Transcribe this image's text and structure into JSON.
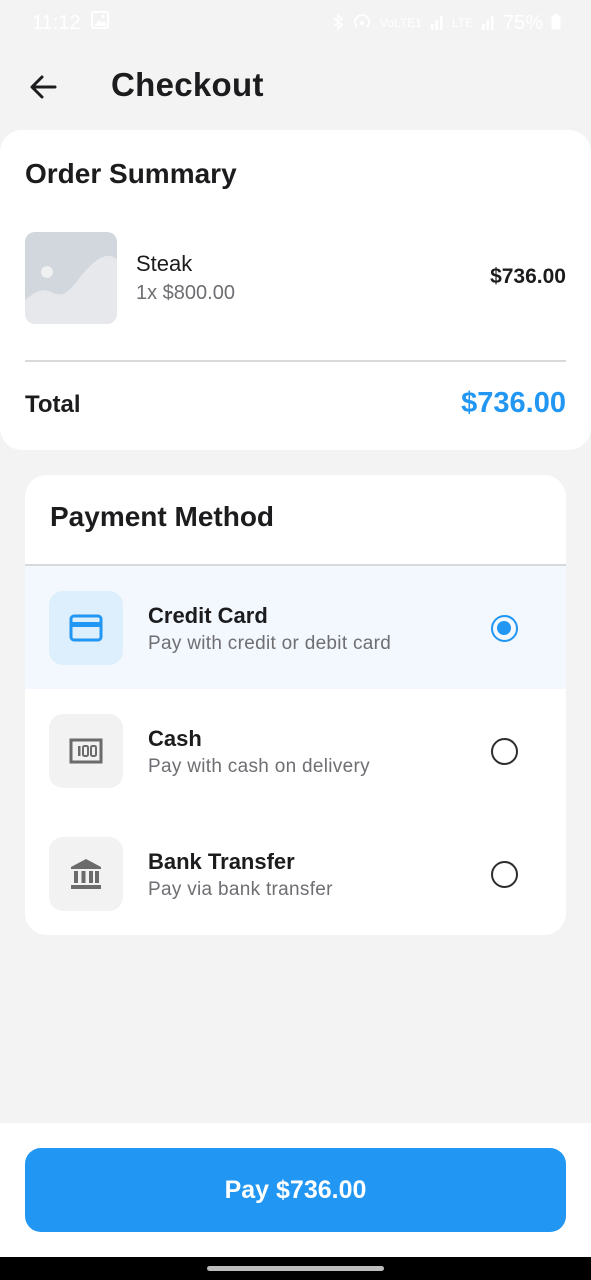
{
  "status_bar": {
    "time": "11:12",
    "network_label_1": "VoLTE1",
    "network_label_2": "LTE",
    "battery": "75%"
  },
  "header": {
    "title": "Checkout",
    "back_icon": "arrow-left-icon"
  },
  "order_summary": {
    "title": "Order Summary",
    "items": [
      {
        "name": "Steak",
        "quantity_price": "1x $800.00",
        "price": "$736.00",
        "thumbnail_icon": "image-placeholder-icon"
      }
    ],
    "total_label": "Total",
    "total_value": "$736.00"
  },
  "payment": {
    "title": "Payment Method",
    "options": [
      {
        "title": "Credit Card",
        "subtitle": "Pay with credit or debit card",
        "icon": "credit-card-icon",
        "selected": true
      },
      {
        "title": "Cash",
        "subtitle": "Pay with cash on delivery",
        "icon": "cash-icon",
        "selected": false
      },
      {
        "title": "Bank Transfer",
        "subtitle": "Pay via bank transfer",
        "icon": "bank-icon",
        "selected": false
      }
    ]
  },
  "pay_button": {
    "label": "Pay $736.00"
  },
  "colors": {
    "accent": "#2196f3",
    "background": "#f3f3f3",
    "selected_row": "#f2f8fd"
  }
}
